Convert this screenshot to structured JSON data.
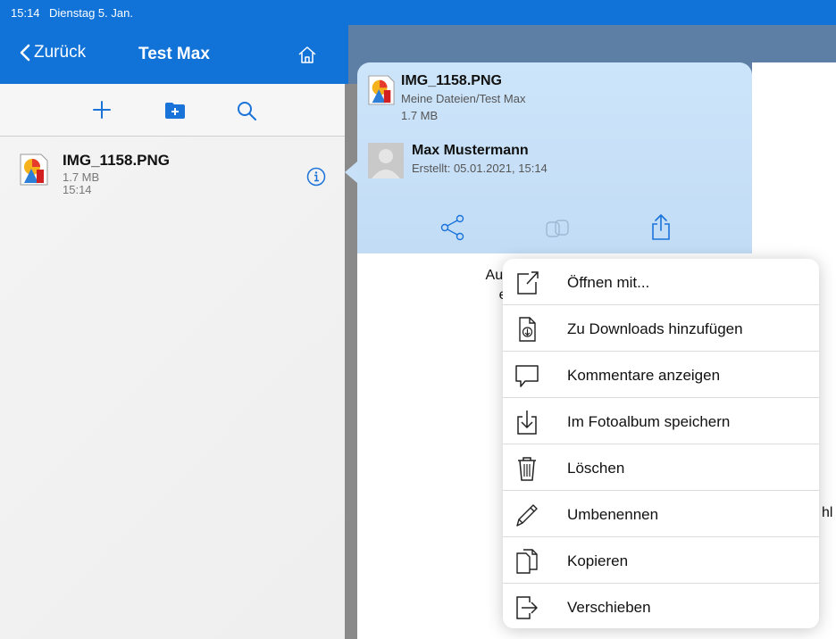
{
  "status": {
    "time": "15:14",
    "date": "Dienstag 5. Jan."
  },
  "nav": {
    "back_label": "Zurück",
    "title": "Test Max"
  },
  "file": {
    "name": "IMG_1158.PNG",
    "size": "1.7 MB",
    "time": "15:14"
  },
  "popover": {
    "file_name": "IMG_1158.PNG",
    "path": "Meine Dateien/Test Max",
    "size": "1.7 MB",
    "owner": "Max Mustermann",
    "created": "Erstellt: 05.01.2021, 15:14"
  },
  "behind_text": {
    "line1": "Auf das Freigab",
    "line2": "einzugeben",
    "right": "hl"
  },
  "menu": {
    "items": [
      {
        "label": "Öffnen mit...",
        "icon": "open-with-icon"
      },
      {
        "label": "Zu Downloads hinzufügen",
        "icon": "download-doc-icon"
      },
      {
        "label": "Kommentare anzeigen",
        "icon": "comment-icon"
      },
      {
        "label": "Im Fotoalbum speichern",
        "icon": "save-photo-icon"
      },
      {
        "label": "Löschen",
        "icon": "trash-icon"
      },
      {
        "label": "Umbenennen",
        "icon": "pencil-icon"
      },
      {
        "label": "Kopieren",
        "icon": "copy-icon"
      },
      {
        "label": "Verschieben",
        "icon": "move-icon"
      }
    ]
  },
  "colors": {
    "nav_blue": "#1173d8",
    "accent": "#1a73d9",
    "popover_bg": "#c8e0f8"
  }
}
